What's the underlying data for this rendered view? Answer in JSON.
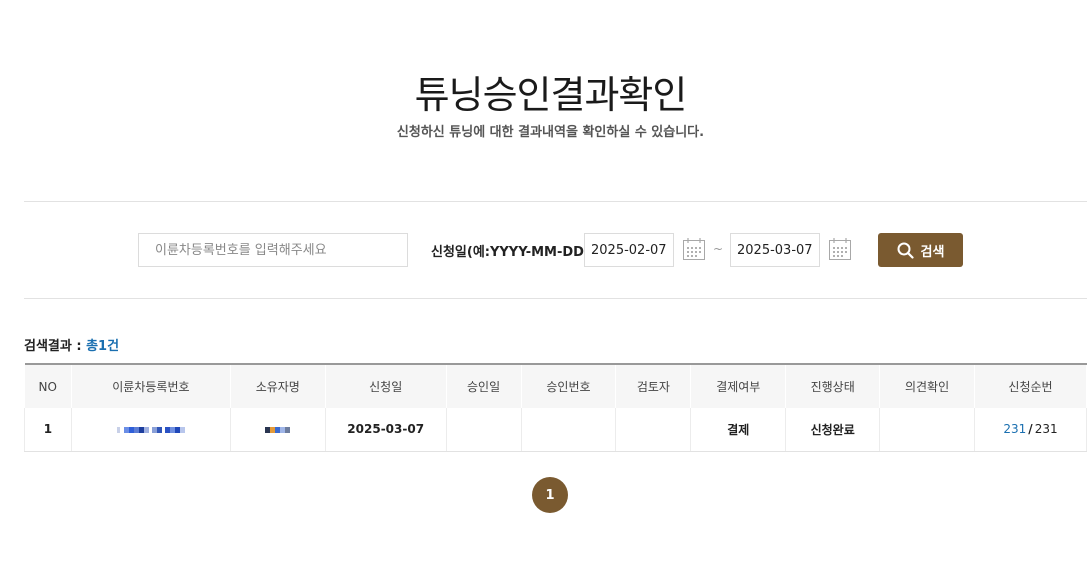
{
  "header": {
    "title": "튜닝승인결과확인",
    "subtitle": "신청하신 튜닝에 대한 결과내역을 확인하실 수 있습니다."
  },
  "search": {
    "placeholder": "이륜차등록번호를 입력해주세요",
    "date_label": "신청일(예:YYYY-MM-DD)",
    "date_from": "2025-02-07",
    "date_separator": "~",
    "date_to": "2025-03-07",
    "button_label": "검색",
    "icons": [
      "calendar-icon",
      "search-icon"
    ]
  },
  "results": {
    "label": "검색결과 : ",
    "count": "총1건"
  },
  "table": {
    "columns": [
      "NO",
      "이륜차등록번호",
      "소유자명",
      "신청일",
      "승인일",
      "승인번호",
      "검토자",
      "결제여부",
      "진행상태",
      "의견확인",
      "신청순번"
    ],
    "rows": [
      {
        "no": "1",
        "reg_number": "",
        "owner": "",
        "applied_date": "2025-03-07",
        "approved_date": "",
        "approval_number": "",
        "reviewer": "",
        "payment": "결제",
        "status": "신청완료",
        "opinion": "",
        "seq_current": "231",
        "seq_sep": "/",
        "seq_total": "231"
      }
    ]
  },
  "pagination": {
    "current": "1"
  },
  "colors": {
    "accent_brown": "#7a5a30",
    "link_blue": "#1a6fb0"
  }
}
